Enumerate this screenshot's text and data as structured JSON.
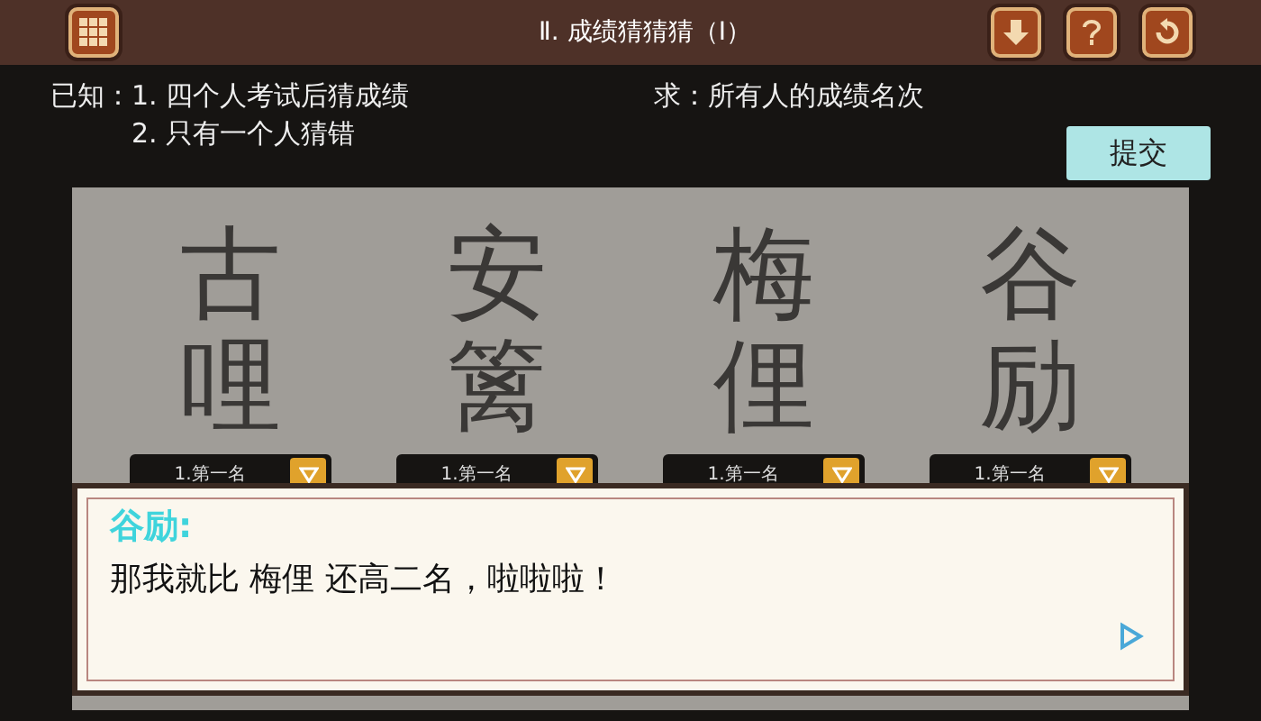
{
  "header": {
    "title": "Ⅱ. 成绩猜猜猜（Ⅰ）"
  },
  "known": {
    "label": "已知：",
    "items": [
      "1. 四个人考试后猜成绩",
      "2. 只有一个人猜错"
    ]
  },
  "goal": {
    "label": "求：",
    "text": "所有人的成绩名次"
  },
  "submit": {
    "label": "提交"
  },
  "people": [
    {
      "name": "古哩",
      "rank": "1.第一名"
    },
    {
      "name": "安篱",
      "rank": "1.第一名"
    },
    {
      "name": "梅俚",
      "rank": "1.第一名"
    },
    {
      "name": "谷励",
      "rank": "1.第一名"
    }
  ],
  "dialog": {
    "speaker": "谷励:",
    "text": "那我就比 梅俚 还高二名，啦啦啦！"
  }
}
